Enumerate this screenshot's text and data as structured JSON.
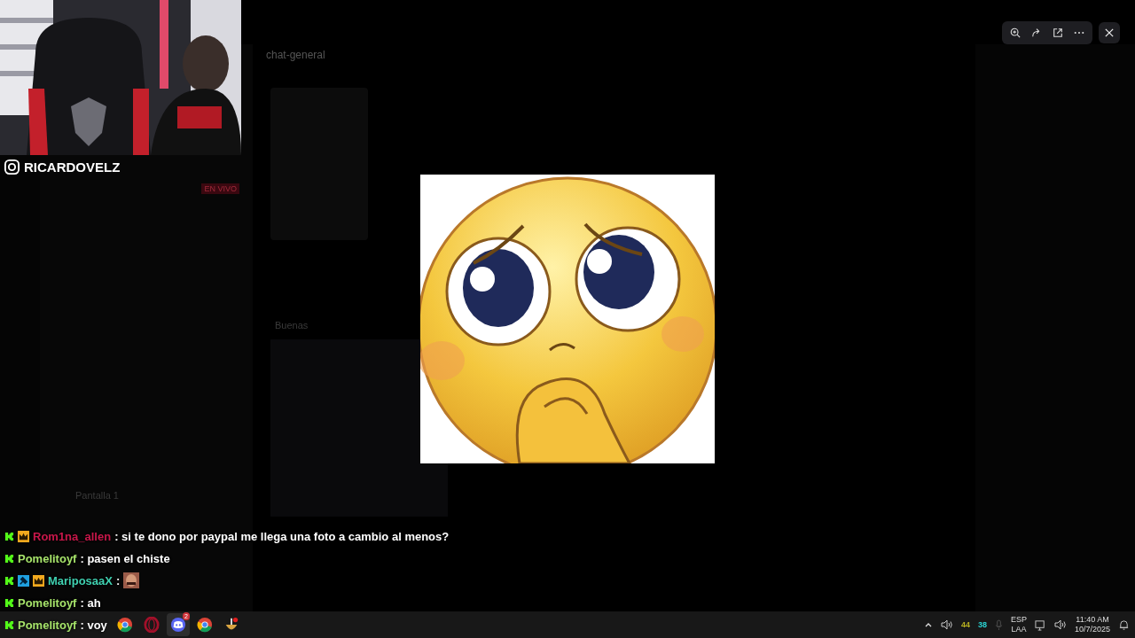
{
  "stream_overlay": {
    "instagram_handle": "RICARDOVELZ"
  },
  "background_app": {
    "channel_name": "chat-general",
    "live_badge": "EN VIVO",
    "message": "Buenas",
    "screen_share": "Pantalla 1"
  },
  "image_viewer": {
    "tools": [
      {
        "kind": "zoom"
      },
      {
        "kind": "forward"
      },
      {
        "kind": "open"
      },
      {
        "kind": "more"
      }
    ]
  },
  "chat": [
    {
      "badges": [
        {
          "kind": "kick"
        },
        {
          "kind": "crown"
        }
      ],
      "user": "Rom1na_allen",
      "color": "#c8174a",
      "text": ": si te dono por paypal me llega una foto a cambio al menos?"
    },
    {
      "badges": [
        {
          "kind": "kick"
        }
      ],
      "user": "Pomelitoyf",
      "color": "#a6e36a",
      "text": ": pasen el chiste"
    },
    {
      "badges": [
        {
          "kind": "kick"
        },
        {
          "kind": "hammer"
        },
        {
          "kind": "crown"
        }
      ],
      "user": "MariposaaX",
      "color": "#3fd0b0",
      "text": ":",
      "emote": true
    },
    {
      "badges": [
        {
          "kind": "kick"
        }
      ],
      "user": "Pomelitoyf",
      "color": "#a6e36a",
      "text": ": ah"
    },
    {
      "badges": [
        {
          "kind": "kick"
        }
      ],
      "user": "Pomelitoyf",
      "color": "#a6e36a",
      "text": ": voy"
    }
  ],
  "taskbar": {
    "apps": [
      {
        "kind": "chrome",
        "selected": false
      },
      {
        "kind": "opera",
        "selected": false
      },
      {
        "kind": "discord",
        "selected": true,
        "badge": "2"
      },
      {
        "kind": "chrome",
        "selected": false
      },
      {
        "kind": "alert",
        "selected": false
      }
    ],
    "tray": {
      "reading_1": "44",
      "reading_2": "38",
      "language": "ESP",
      "layout": "LAA",
      "time": "11:40 AM",
      "date": "10/7/2025"
    }
  }
}
